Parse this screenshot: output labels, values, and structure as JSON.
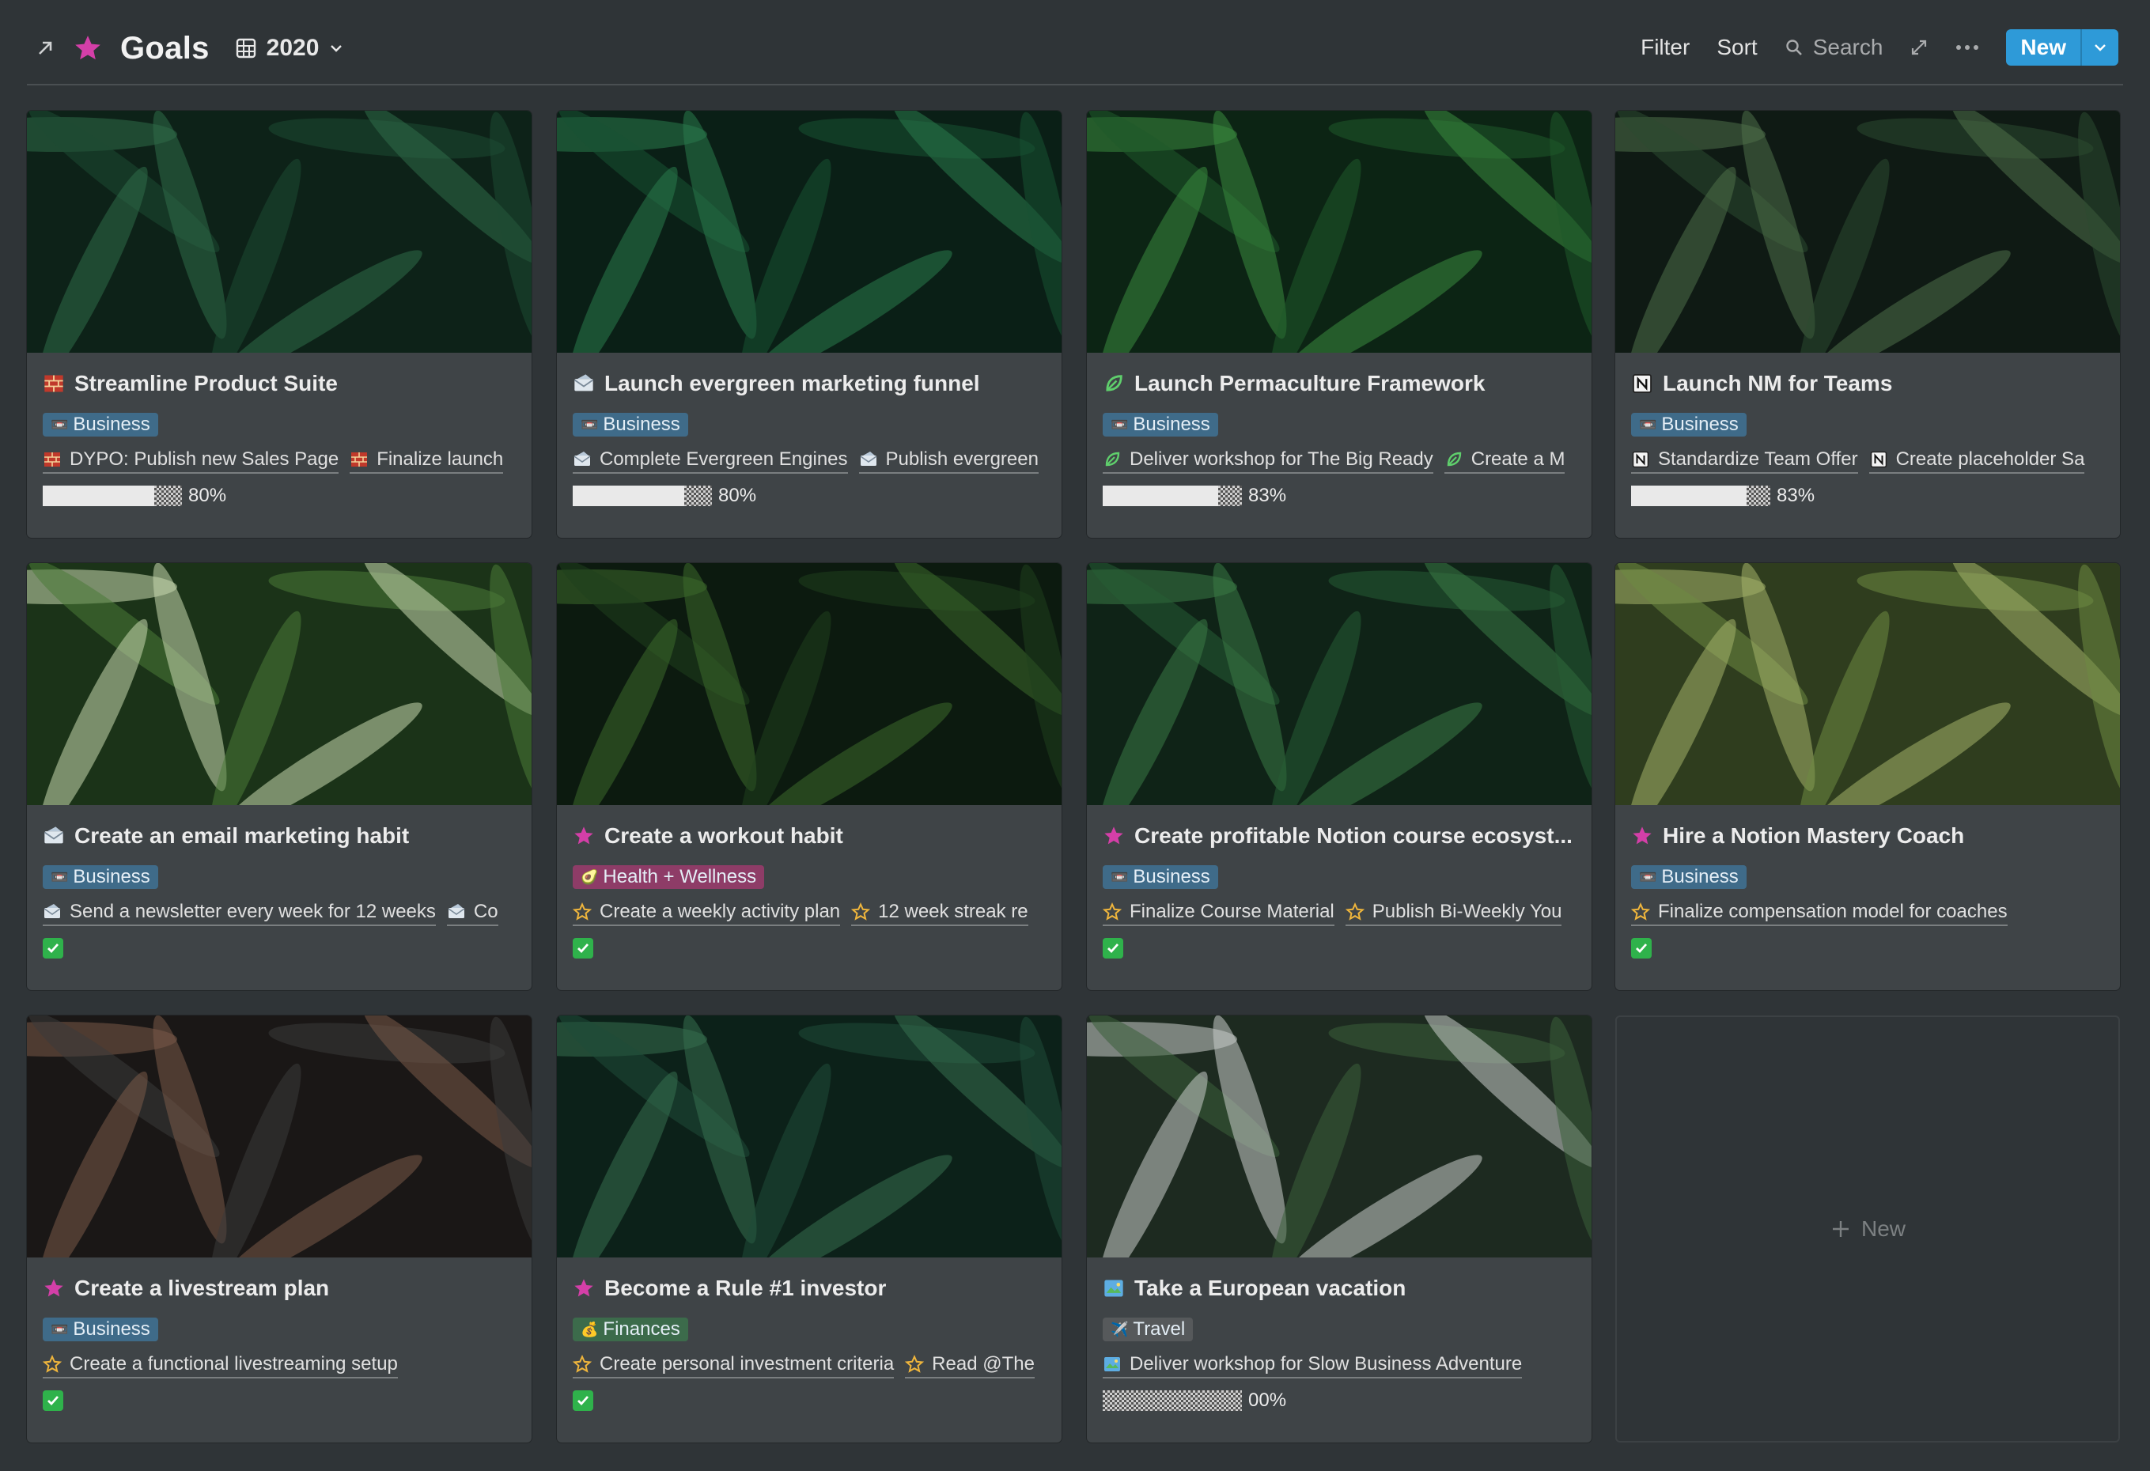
{
  "header": {
    "title": "Goals",
    "view_name": "2020",
    "filter_label": "Filter",
    "sort_label": "Sort",
    "search_label": "Search",
    "new_label": "New"
  },
  "colors": {
    "business_tag": "#3f6b89",
    "health_tag": "#8e3c67",
    "finances_tag": "#3c6b4b",
    "travel_tag": "#56595b",
    "star_pink": "#d43fa8",
    "new_button": "#2e9ad8"
  },
  "cards": [
    {
      "title": "Streamline Product Suite",
      "icon": "bricks-icon",
      "tag": "Business",
      "tag_prefix": "📼",
      "relations": [
        "DYPO: Publish new Sales Page",
        "Finalize launch"
      ],
      "progress_label": "80%",
      "progress": 0.8
    },
    {
      "title": "Launch evergreen marketing funnel",
      "icon": "envelope-icon",
      "tag": "Business",
      "tag_prefix": "📼",
      "relations": [
        "Complete Evergreen Engines",
        "Publish evergreen"
      ],
      "progress_label": "80%",
      "progress": 0.8
    },
    {
      "title": "Launch Permaculture Framework",
      "icon": "leaf-icon",
      "tag": "Business",
      "tag_prefix": "📼",
      "relations": [
        "Deliver workshop for The Big Ready",
        "Create a M"
      ],
      "progress_label": "83%",
      "progress": 0.83
    },
    {
      "title": "Launch NM for Teams",
      "icon": "notion-icon",
      "tag": "Business",
      "tag_prefix": "📼",
      "relations": [
        "Standardize Team Offer",
        "Create placeholder Sa"
      ],
      "progress_label": "83%",
      "progress": 0.83
    },
    {
      "title": "Create an email marketing habit",
      "icon": "envelope-icon",
      "tag": "Business",
      "tag_prefix": "📼",
      "relations": [
        "Send a newsletter every week for 12 weeks",
        "Co"
      ],
      "done": true
    },
    {
      "title": "Create a workout habit",
      "icon": "star-icon",
      "tag": "Health + Wellness",
      "tag_prefix": "🥑",
      "relations": [
        "Create a weekly activity plan",
        "12 week streak re"
      ],
      "done": true
    },
    {
      "title": "Create profitable Notion course ecosyst...",
      "icon": "star-icon",
      "tag": "Business",
      "tag_prefix": "📼",
      "relations": [
        "Finalize Course Material",
        "Publish Bi-Weekly You"
      ],
      "done": true
    },
    {
      "title": "Hire a Notion Mastery Coach",
      "icon": "star-icon",
      "tag": "Business",
      "tag_prefix": "📼",
      "relations": [
        "Finalize compensation model for coaches"
      ],
      "done": true
    },
    {
      "title": "Create a livestream plan",
      "icon": "star-icon",
      "tag": "Business",
      "tag_prefix": "📼",
      "relations": [
        "Create a functional livestreaming setup"
      ],
      "done": true
    },
    {
      "title": "Become a Rule #1 investor",
      "icon": "star-icon",
      "tag": "Finances",
      "tag_prefix": "💰",
      "relations": [
        "Create personal investment criteria",
        "Read @The"
      ],
      "done": true
    },
    {
      "title": "Take a European vacation",
      "icon": "map-icon",
      "tag": "Travel",
      "tag_prefix": "✈️",
      "relations": [
        "Deliver workshop for Slow Business Adventure"
      ],
      "progress_label": "00%",
      "progress": 0
    }
  ],
  "add_card": {
    "label": "New"
  }
}
